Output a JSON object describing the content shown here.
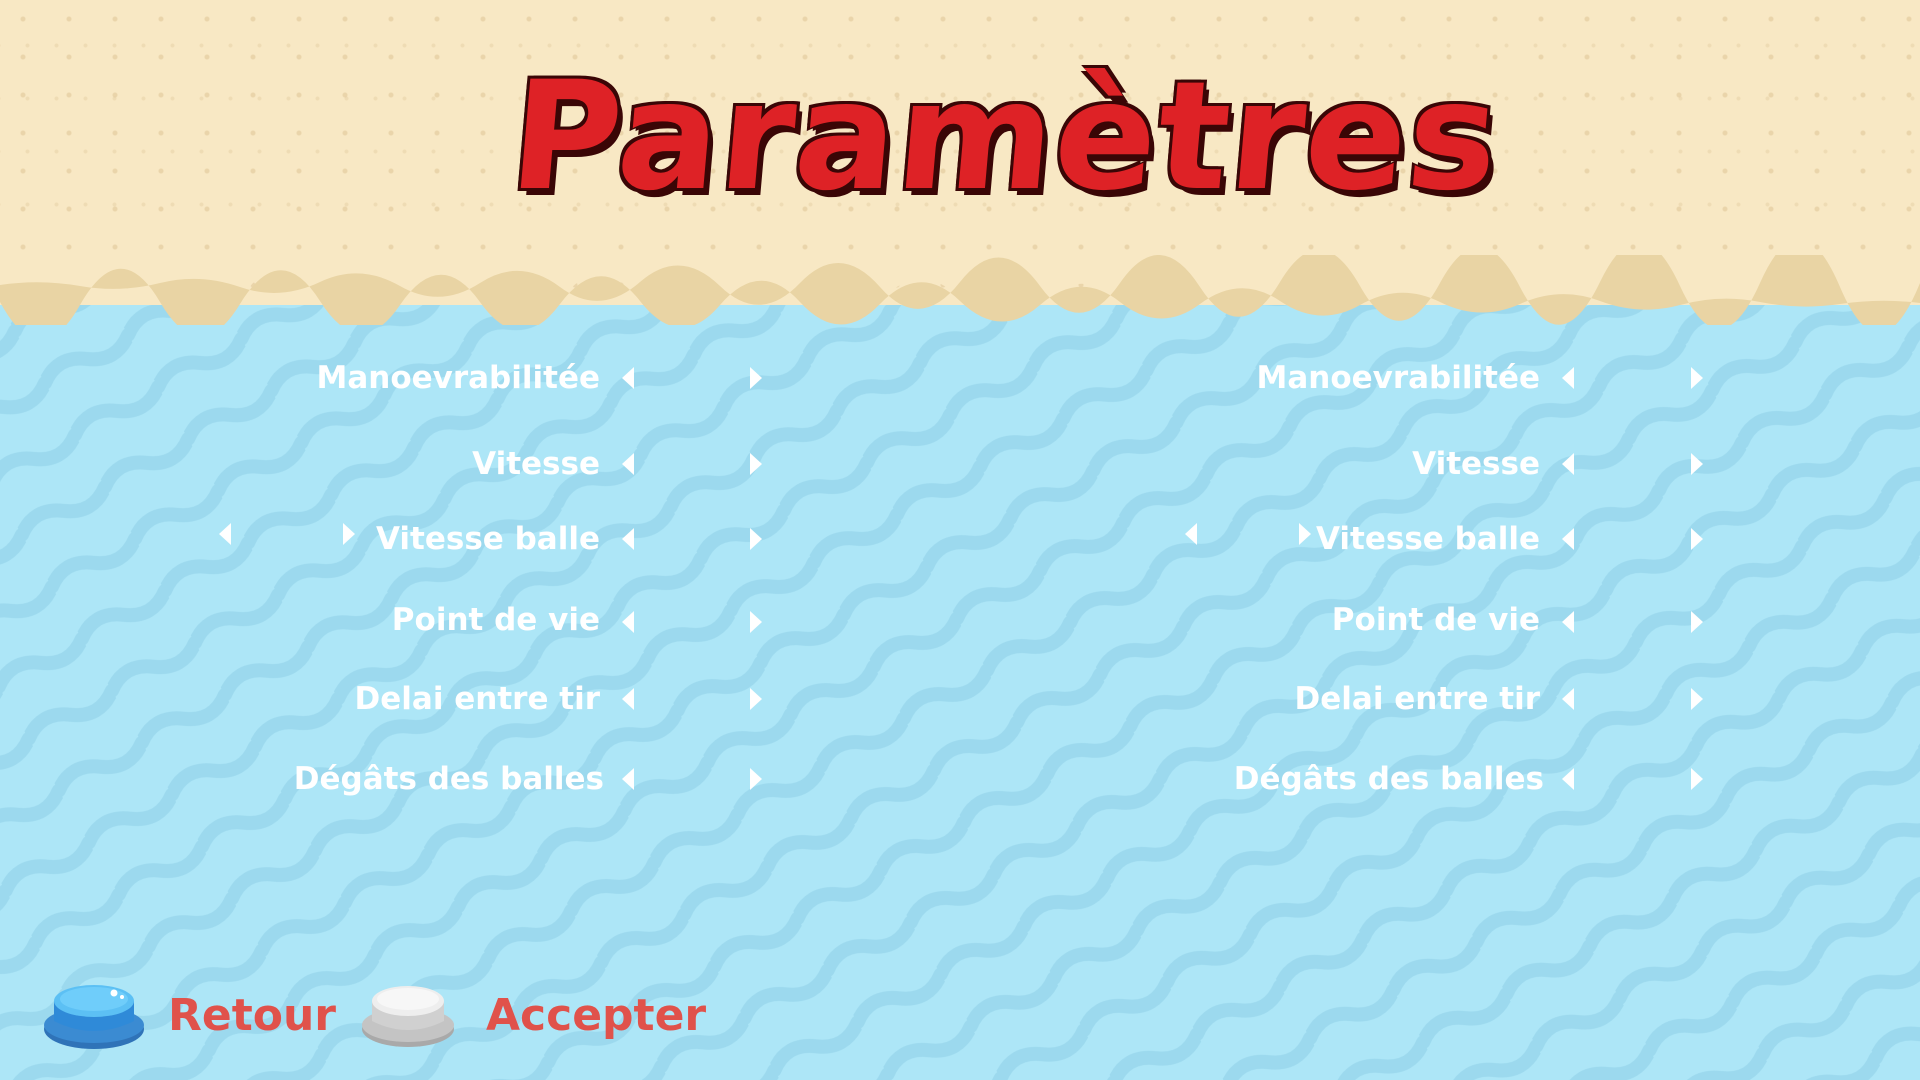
{
  "title": "Paramètres",
  "players": [
    {
      "settings": [
        {
          "label": "Manoevrabilitée"
        },
        {
          "label": "Vitesse"
        },
        {
          "label": "Vitesse balle"
        },
        {
          "label": "Point de vie"
        },
        {
          "label": "Delai entre tir"
        },
        {
          "label": "Dégâts des balles"
        }
      ]
    },
    {
      "settings": [
        {
          "label": "Manoevrabilitée"
        },
        {
          "label": "Vitesse"
        },
        {
          "label": "Vitesse balle"
        },
        {
          "label": "Point de vie"
        },
        {
          "label": "Delai entre tir"
        },
        {
          "label": "Dégâts des balles"
        }
      ]
    }
  ],
  "buttons": {
    "back_label": "Retour",
    "accept_label": "Accepter"
  },
  "colors": {
    "title": "#de2226",
    "sand": "#f8e8c4",
    "water": "#ade6f7",
    "button_label": "#e0524b",
    "back_button": "#4aa6e0",
    "accept_button": "#e6e6e6"
  },
  "icons": {
    "back_button": "blue-round-button-icon",
    "accept_button": "white-round-button-icon",
    "arrows": "triangle-arrow-icon"
  }
}
